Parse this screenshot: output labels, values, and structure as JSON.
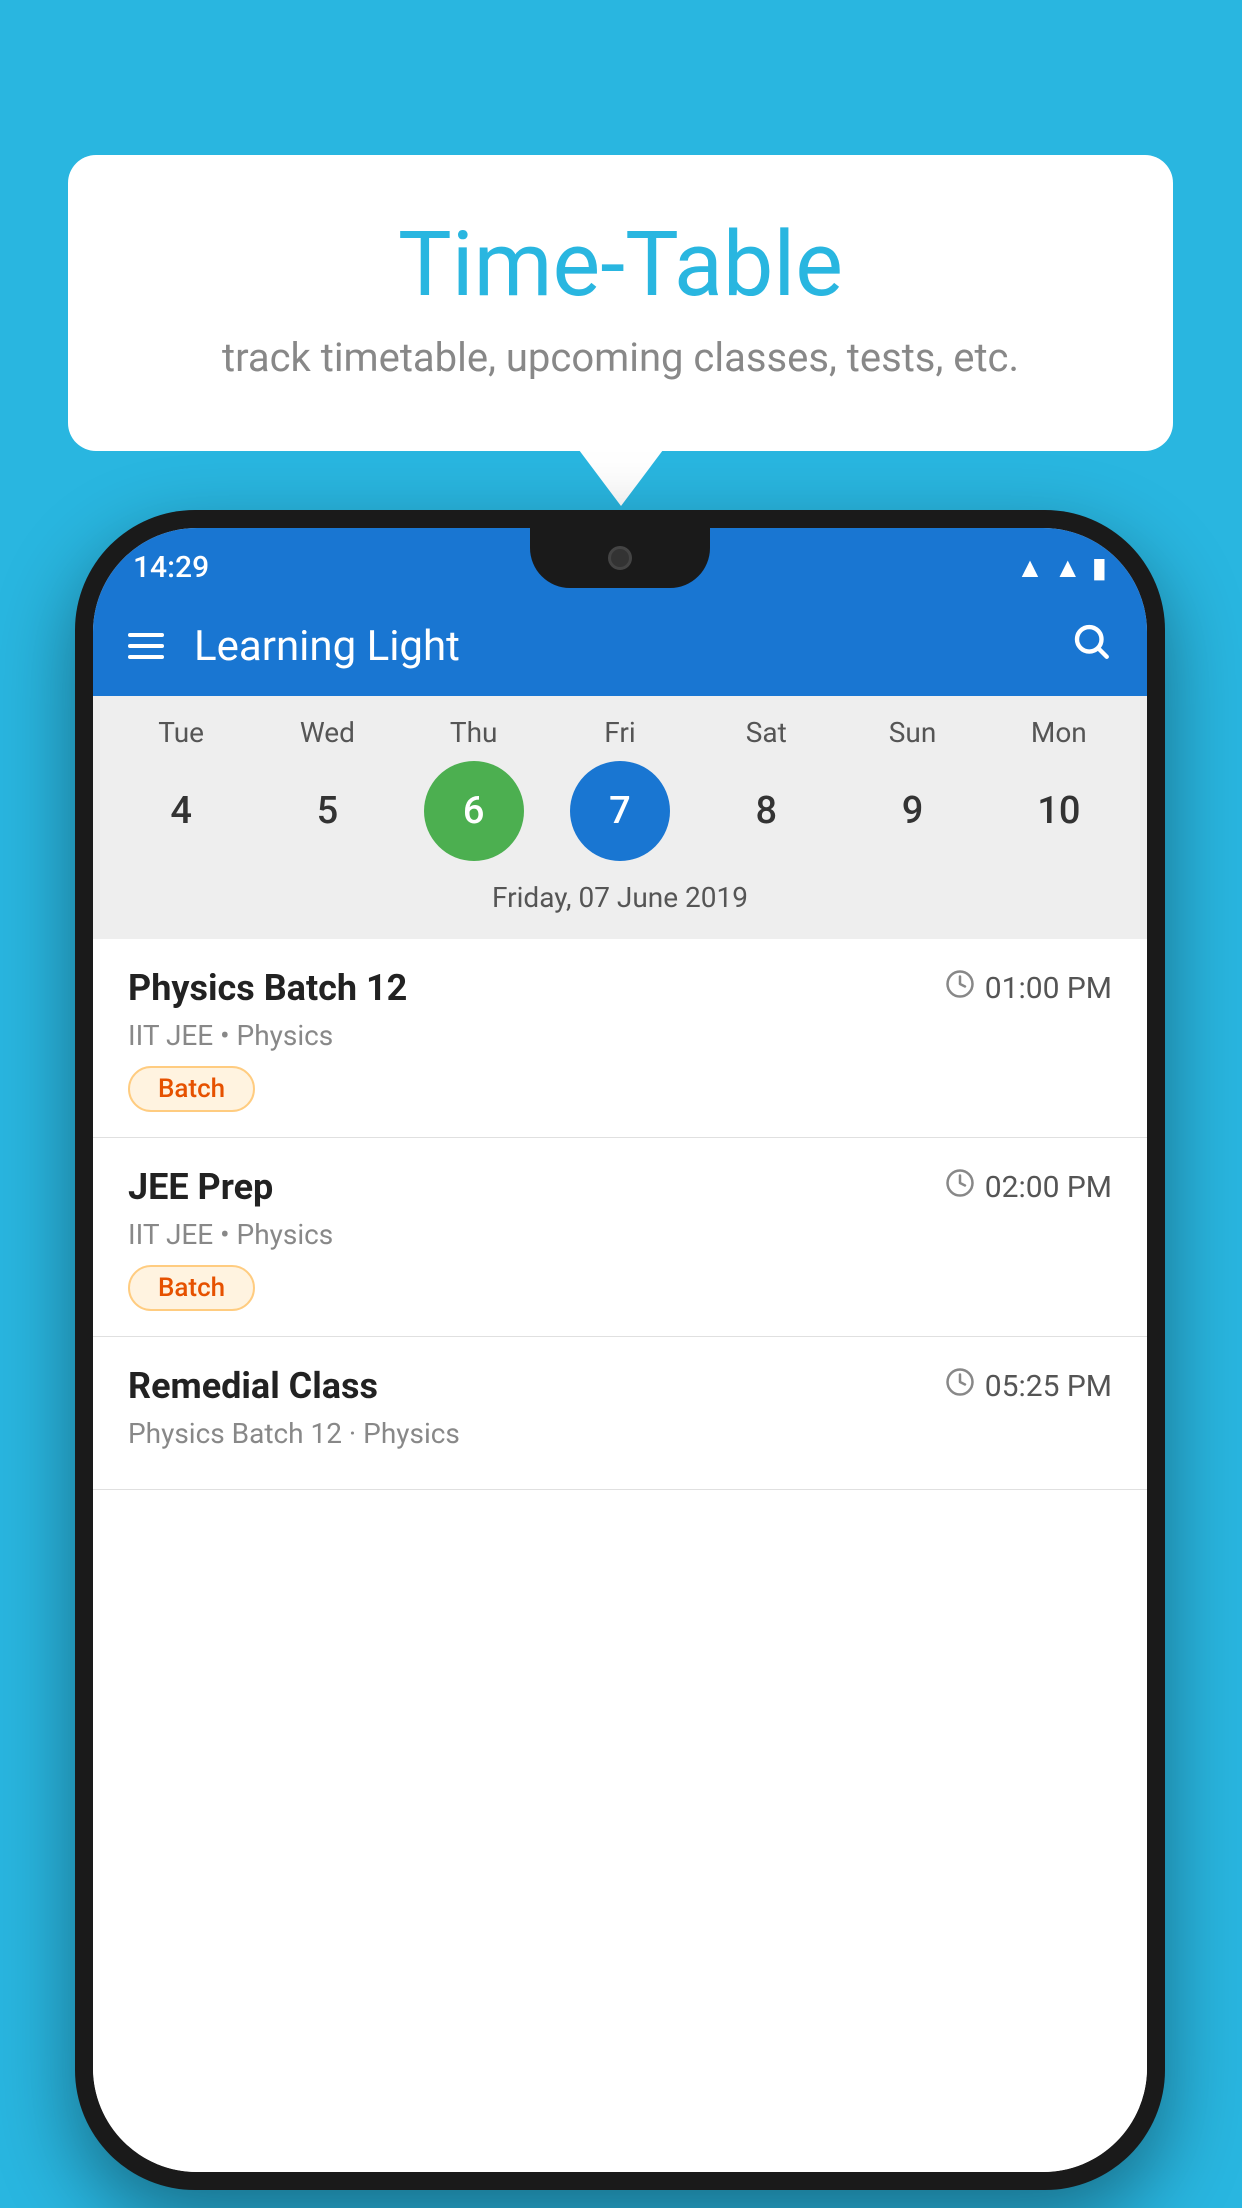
{
  "background": {
    "color": "#29b6e0"
  },
  "speech_bubble": {
    "title": "Time-Table",
    "subtitle": "track timetable, upcoming classes, tests, etc."
  },
  "phone": {
    "status_bar": {
      "time": "14:29"
    },
    "app_bar": {
      "title": "Learning Light"
    },
    "calendar": {
      "days": [
        {
          "name": "Tue",
          "num": "4",
          "state": "normal"
        },
        {
          "name": "Wed",
          "num": "5",
          "state": "normal"
        },
        {
          "name": "Thu",
          "num": "6",
          "state": "today"
        },
        {
          "name": "Fri",
          "num": "7",
          "state": "selected"
        },
        {
          "name": "Sat",
          "num": "8",
          "state": "normal"
        },
        {
          "name": "Sun",
          "num": "9",
          "state": "normal"
        },
        {
          "name": "Mon",
          "num": "10",
          "state": "normal"
        }
      ],
      "selected_date_label": "Friday, 07 June 2019"
    },
    "schedule": [
      {
        "name": "Physics Batch 12",
        "time": "01:00 PM",
        "meta": "IIT JEE • Physics",
        "badge": "Batch"
      },
      {
        "name": "JEE Prep",
        "time": "02:00 PM",
        "meta": "IIT JEE • Physics",
        "badge": "Batch"
      },
      {
        "name": "Remedial Class",
        "time": "05:25 PM",
        "meta": "Physics Batch 12 · Physics",
        "badge": ""
      }
    ]
  }
}
